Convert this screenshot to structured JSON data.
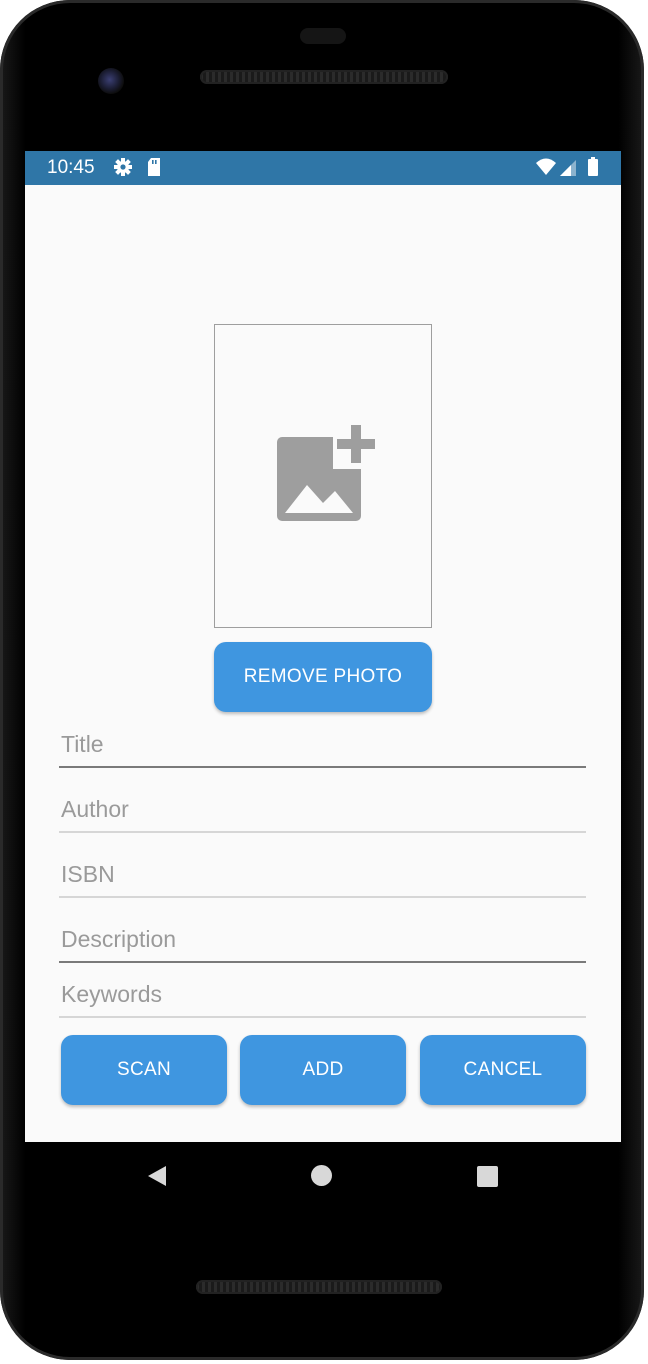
{
  "status_bar": {
    "time": "10:45",
    "left_icons": [
      "gear-icon",
      "sd-card-icon"
    ],
    "right_icons": [
      "wifi-icon",
      "signal-icon",
      "battery-icon"
    ],
    "color": "#2f76a7"
  },
  "photo": {
    "placeholder_icon": "add-photo-icon"
  },
  "buttons": {
    "remove_photo": "REMOVE PHOTO",
    "scan": "SCAN",
    "add": "ADD",
    "cancel": "CANCEL",
    "color": "#3f96e0"
  },
  "fields": {
    "title": {
      "placeholder": "Title",
      "value": ""
    },
    "author": {
      "placeholder": "Author",
      "value": ""
    },
    "isbn": {
      "placeholder": "ISBN",
      "value": ""
    },
    "description": {
      "placeholder": "Description",
      "value": ""
    },
    "keywords": {
      "placeholder": "Keywords",
      "value": ""
    }
  },
  "nav_bar": {
    "icons": [
      "back-icon",
      "home-icon",
      "recents-icon"
    ]
  }
}
